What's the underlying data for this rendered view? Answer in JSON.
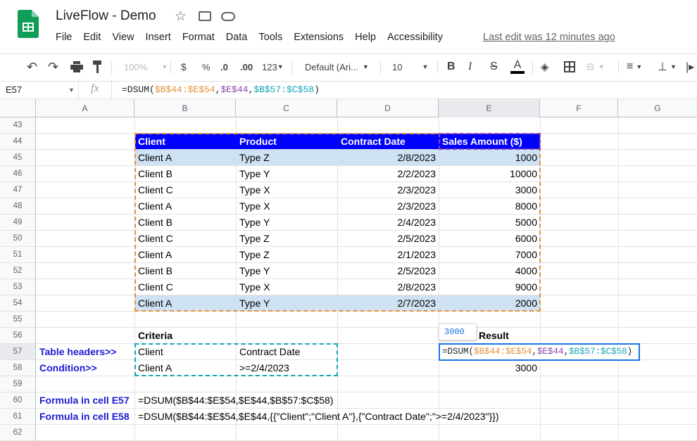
{
  "app": {
    "title": "LiveFlow - Demo",
    "last_edit": "Last edit was 12 minutes ago"
  },
  "menu": [
    "File",
    "Edit",
    "View",
    "Insert",
    "Format",
    "Data",
    "Tools",
    "Extensions",
    "Help",
    "Accessibility"
  ],
  "toolbar": {
    "zoom": "100%",
    "currency": "$",
    "percent": "%",
    "dec_less": ".0",
    "dec_more": ".00",
    "num_format": "123",
    "font": "Default (Ari...",
    "font_size": "10",
    "bold": "B",
    "italic": "I",
    "strike": "S",
    "text_color": "A"
  },
  "formula_bar": {
    "cell_ref": "E57",
    "fx": "fx",
    "formula_prefix": "=DSUM(",
    "arg1": "$B$44:$E$54",
    "comma": ",",
    "arg2": "$E$44",
    "arg3": "$B$57:$C$58",
    "close": ")"
  },
  "columns": [
    "A",
    "B",
    "C",
    "D",
    "E",
    "F",
    "G"
  ],
  "rows": [
    "43",
    "44",
    "45",
    "46",
    "47",
    "48",
    "49",
    "50",
    "51",
    "52",
    "53",
    "54",
    "55",
    "56",
    "57",
    "58",
    "59",
    "60",
    "61",
    "62"
  ],
  "table": {
    "headers": [
      "Client",
      "Product",
      "Contract Date",
      "Sales Amount ($)"
    ],
    "rows": [
      [
        "Client A",
        "Type Z",
        "2/8/2023",
        "1000"
      ],
      [
        "Client B",
        "Type Y",
        "2/2/2023",
        "10000"
      ],
      [
        "Client C",
        "Type X",
        "2/3/2023",
        "3000"
      ],
      [
        "Client A",
        "Type X",
        "2/3/2023",
        "8000"
      ],
      [
        "Client B",
        "Type Y",
        "2/4/2023",
        "5000"
      ],
      [
        "Client C",
        "Type Z",
        "2/5/2023",
        "6000"
      ],
      [
        "Client A",
        "Type Z",
        "2/1/2023",
        "7000"
      ],
      [
        "Client B",
        "Type Y",
        "2/5/2023",
        "4000"
      ],
      [
        "Client C",
        "Type X",
        "2/8/2023",
        "9000"
      ],
      [
        "Client A",
        "Type Y",
        "2/7/2023",
        "2000"
      ]
    ]
  },
  "criteria": {
    "title": "Criteria",
    "header_label": "Table headers>>",
    "condition_label": "Condition>>",
    "h1": "Client",
    "h2": "Contract Date",
    "c1": "Client A",
    "c2": ">=2/4/2023"
  },
  "result": {
    "title": "Result",
    "preview": "3000",
    "close": "×",
    "value": "3000"
  },
  "notes": [
    {
      "label": "Formula in cell E57",
      "formula": "=DSUM($B$44:$E$54,$E$44,$B$57:$C$58)"
    },
    {
      "label": "Formula in cell E58",
      "formula": "=DSUM($B$44:$E$54,$E$44,{{\"Client\";\"Client A\"},{\"Contract Date\";\">=2/4/2023\"}})"
    }
  ],
  "colors": {
    "header_bg": "#0000ff",
    "highlight_row": "#cfe2f3",
    "orange": "#e69138",
    "teal": "#12a5b8",
    "purple": "#8e44ad",
    "label_blue": "#1a1ad4"
  }
}
